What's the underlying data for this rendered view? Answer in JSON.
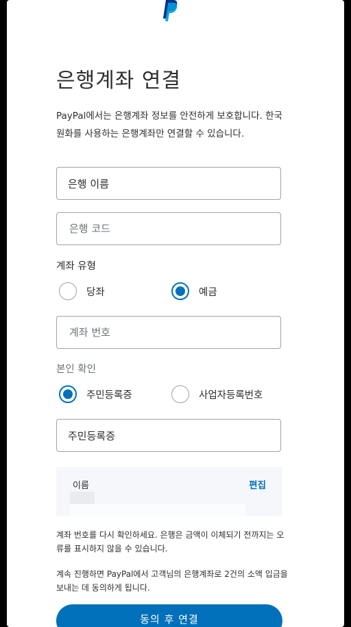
{
  "brand": {
    "logo_icon": "paypal-logo-icon",
    "logo_colors": [
      "#003087",
      "#009cde"
    ]
  },
  "page": {
    "title": "은행계좌 연결",
    "intro": "PayPal에서는 은행계좌 정보를 안전하게 보호합니다. 한국 원화를 사용하는 은행계좌만 연결할 수 있습니다."
  },
  "form": {
    "bank_name": {
      "value": "은행 이름"
    },
    "bank_code": {
      "placeholder": "은행 코드"
    },
    "account_type": {
      "label": "계좌 유형",
      "options": [
        {
          "label": "당좌",
          "selected": false
        },
        {
          "label": "예금",
          "selected": true
        }
      ]
    },
    "account_number": {
      "placeholder": "계좌 번호"
    },
    "identity": {
      "label": "본인 확인",
      "options": [
        {
          "label": "주민등록증",
          "selected": true
        },
        {
          "label": "사업자등록번호",
          "selected": false
        }
      ]
    },
    "id_number": {
      "value": "주민등록증"
    }
  },
  "name_section": {
    "label": "이름",
    "edit_label": "편집"
  },
  "notices": {
    "verify": "계좌 번호를 다시 확인하세요. 은행은 금액이 이체되기 전까지는 오류를 표시하지 않을 수 있습니다.",
    "consent": "계속 진행하면 PayPal에서 고객님의 은행계좌로 2건의 소액 입금을 보내는 데 동의하게 됩니다."
  },
  "cta": {
    "label": "동의 후 연결"
  },
  "colors": {
    "accent": "#0070ba",
    "text": "#2c2e2f",
    "muted": "#6c7378",
    "border": "#9da3a6"
  }
}
